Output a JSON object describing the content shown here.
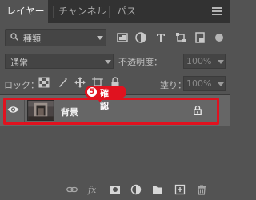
{
  "tabs": [
    {
      "label": "レイヤー",
      "active": true
    },
    {
      "label": "チャンネル",
      "active": false
    },
    {
      "label": "パス",
      "active": false
    }
  ],
  "filter": {
    "kind_label": "種類"
  },
  "blend": {
    "mode": "通常",
    "opacity_label": "不透明度：",
    "opacity_value": "100%"
  },
  "lock": {
    "label": "ロック：",
    "fill_label": "塗り：",
    "fill_value": "100%"
  },
  "layers": [
    {
      "name": "背景",
      "visible": true,
      "locked": true
    }
  ],
  "callout": {
    "number": "5",
    "text": "確 認",
    "color": "#e0121f"
  },
  "icons": {
    "filter": [
      "image-icon",
      "adjustment-icon",
      "type-icon",
      "shape-icon",
      "smart-object-icon",
      "filter-toggle-icon"
    ],
    "lock": [
      "lock-transparent-pixels-icon",
      "lock-image-pixels-icon",
      "lock-position-icon",
      "lock-artboard-icon",
      "lock-all-icon"
    ],
    "bottom": [
      "link-icon",
      "fx-icon",
      "mask-icon",
      "adjustment-layer-icon",
      "group-folder-icon",
      "new-layer-icon",
      "trash-icon"
    ]
  }
}
